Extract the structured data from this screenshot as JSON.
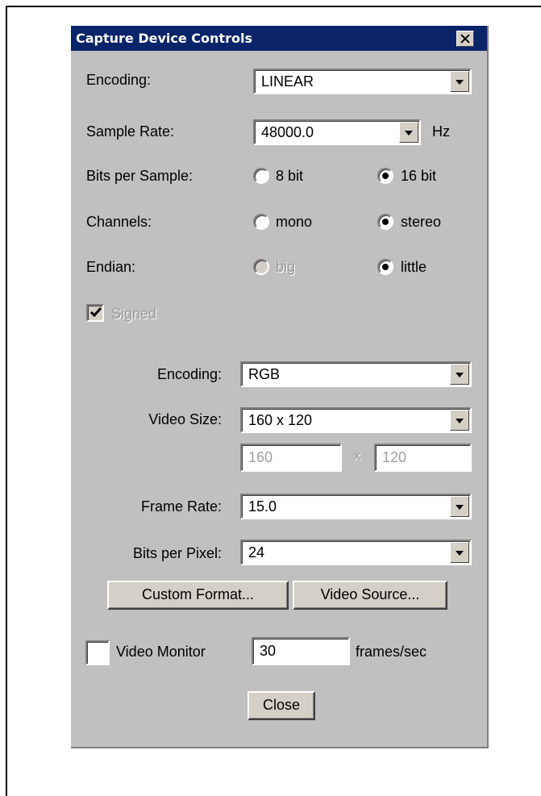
{
  "window": {
    "title": "Capture Device Controls",
    "close_icon": "close-icon"
  },
  "audio": {
    "encoding_label": "Encoding:",
    "encoding_value": "LINEAR",
    "sample_rate_label": "Sample Rate:",
    "sample_rate_value": "48000.0",
    "sample_rate_unit": "Hz",
    "bits_label": "Bits per Sample:",
    "bits_options": [
      "8 bit",
      "16 bit"
    ],
    "bits_selected": "16 bit",
    "channels_label": "Channels:",
    "channels_options": [
      "mono",
      "stereo"
    ],
    "channels_selected": "stereo",
    "endian_label": "Endian:",
    "endian_options": [
      "big",
      "little"
    ],
    "endian_selected": "little",
    "signed_label": "Signed",
    "signed_checked": true
  },
  "video": {
    "encoding_label": "Encoding:",
    "encoding_value": "RGB",
    "size_label": "Video Size:",
    "size_value": "160 x 120",
    "width_value": "160",
    "times_sign": "x",
    "height_value": "120",
    "frame_rate_label": "Frame Rate:",
    "frame_rate_value": "15.0",
    "bpp_label": "Bits per Pixel:",
    "bpp_value": "24"
  },
  "buttons": {
    "custom_format": "Custom Format...",
    "video_source": "Video Source...",
    "close": "Close"
  },
  "monitor": {
    "label": "Video Monitor",
    "checked": false,
    "fps_value": "30",
    "fps_unit": "frames/sec"
  },
  "colors": {
    "titlebar": "#0a246a",
    "dialog_bg": "#c0c0c0",
    "disabled_text": "#9a9a9a"
  }
}
